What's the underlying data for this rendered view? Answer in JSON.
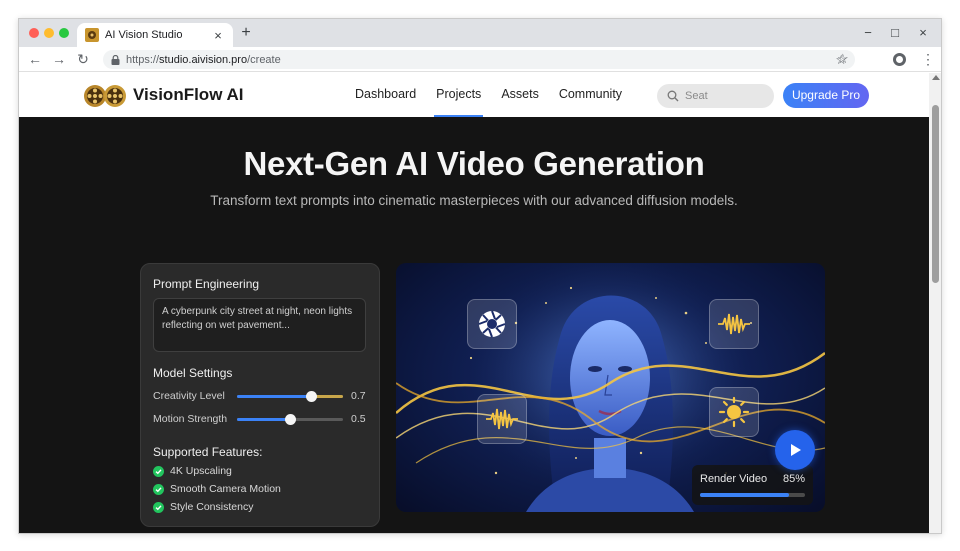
{
  "browser": {
    "tab_title": "AI Vision Studio",
    "tab_close": "×",
    "new_tab": "+",
    "url_prefix": "https://",
    "url_host": "studio.aivision.pro",
    "url_path": "/create",
    "window_minimize": "−",
    "window_maximize": "□",
    "window_close": "×"
  },
  "site": {
    "brand": "VisionFlow AI",
    "nav": [
      "Dashboard",
      "Projects",
      "Assets",
      "Community"
    ],
    "active_nav": "Projects",
    "search_placeholder": "Seat",
    "upgrade_label": "Upgrade Pro"
  },
  "hero": {
    "title": "Next-Gen AI Video Generation",
    "subtitle": "Transform text prompts into cinematic masterpieces with our advanced diffusion models."
  },
  "settings": {
    "prompt_heading": "Prompt Engineering",
    "prompt_text": "A cyberpunk city street at night, neon lights reflecting on wet pavement...",
    "model_heading": "Model Settings",
    "sliders": [
      {
        "label": "Creativity Level",
        "value": 0.7,
        "display": "0.7"
      },
      {
        "label": "Motion Strength",
        "value": 0.5,
        "display": "0.5"
      }
    ],
    "features_heading": "Supported Features:",
    "features": [
      "4K Upscaling",
      "Smooth Camera Motion",
      "Style Consistency"
    ]
  },
  "preview": {
    "render_label": "Render Video",
    "render_percent": "85%",
    "render_progress": 0.85,
    "icons": [
      "aperture-icon",
      "waveform-icon",
      "waveform-icon",
      "sun-icon",
      "play-icon"
    ]
  },
  "colors": {
    "accent": "#3b82f6",
    "success": "#22c55e",
    "page_bg": "#141414",
    "card_bg": "#2a2a2a",
    "gold": "#f5c542"
  }
}
